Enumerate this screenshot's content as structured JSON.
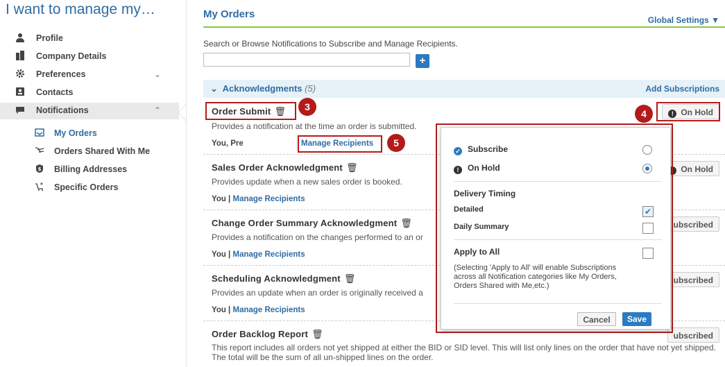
{
  "sidebar": {
    "title": "I want to manage my…",
    "items": [
      {
        "label": "Profile",
        "icon": "person-icon"
      },
      {
        "label": "Company Details",
        "icon": "building-icon"
      },
      {
        "label": "Preferences",
        "icon": "gear-icon"
      },
      {
        "label": "Contacts",
        "icon": "contacts-icon"
      },
      {
        "label": "Notifications",
        "icon": "chat-icon"
      }
    ],
    "subitems": [
      {
        "label": "My Orders",
        "icon": "inbox-icon"
      },
      {
        "label": "Orders Shared With Me",
        "icon": "share-icon"
      },
      {
        "label": "Billing Addresses",
        "icon": "billing-icon"
      },
      {
        "label": "Specific Orders",
        "icon": "cart-star-icon"
      }
    ]
  },
  "main": {
    "title": "My Orders",
    "global_settings": "Global Settings",
    "hint": "Search or Browse Notifications to Subscribe and Manage Recipients.",
    "search_value": "",
    "add_symbol": "+",
    "section": {
      "title": "Acknowledgments",
      "count": "(5)",
      "add_label": "Add Subscriptions"
    },
    "rows": [
      {
        "title": "Order Submit",
        "desc": "Provides a notification at the time an order is submitted.",
        "you": "You, Pre",
        "manage": "Manage Recipients",
        "status": "On Hold"
      },
      {
        "title": "Sales Order Acknowledgment",
        "desc": "Provides update when a new sales order is booked.",
        "you": "You |",
        "manage": "Manage Recipients",
        "status": "On Hold"
      },
      {
        "title": "Change Order Summary Acknowledgment",
        "desc": "Provides a notification on the changes performed to an or",
        "you": "You |",
        "manage": "Manage Recipients",
        "status": "ubscribed"
      },
      {
        "title": "Scheduling Acknowledgment",
        "desc": "Provides an update when an order is originally received a",
        "you": "You |",
        "manage": "Manage Recipients",
        "status": "ubscribed"
      },
      {
        "title": "Order Backlog Report",
        "desc": "This report includes all orders not yet shipped at either the BID or SID level. This will list only lines on the order that have not yet shipped. The total will be the sum of all un-shipped lines on the order.",
        "status": "ubscribed"
      }
    ]
  },
  "popup": {
    "subscribe": "Subscribe",
    "on_hold": "On Hold",
    "delivery_timing": "Delivery Timing",
    "detailed": "Detailed",
    "daily_summary": "Daily Summary",
    "apply_to_all": "Apply to All",
    "note": "(Selecting 'Apply to All' will enable Subscriptions across all Notification categories like My Orders, Orders Shared with Me,etc.)",
    "cancel": "Cancel",
    "save": "Save",
    "check_mark": "✔"
  },
  "callouts": [
    "3",
    "4",
    "5"
  ],
  "colors": {
    "accent": "#2e6ca4",
    "green": "#8dc63f",
    "callout": "#b31b1b"
  }
}
